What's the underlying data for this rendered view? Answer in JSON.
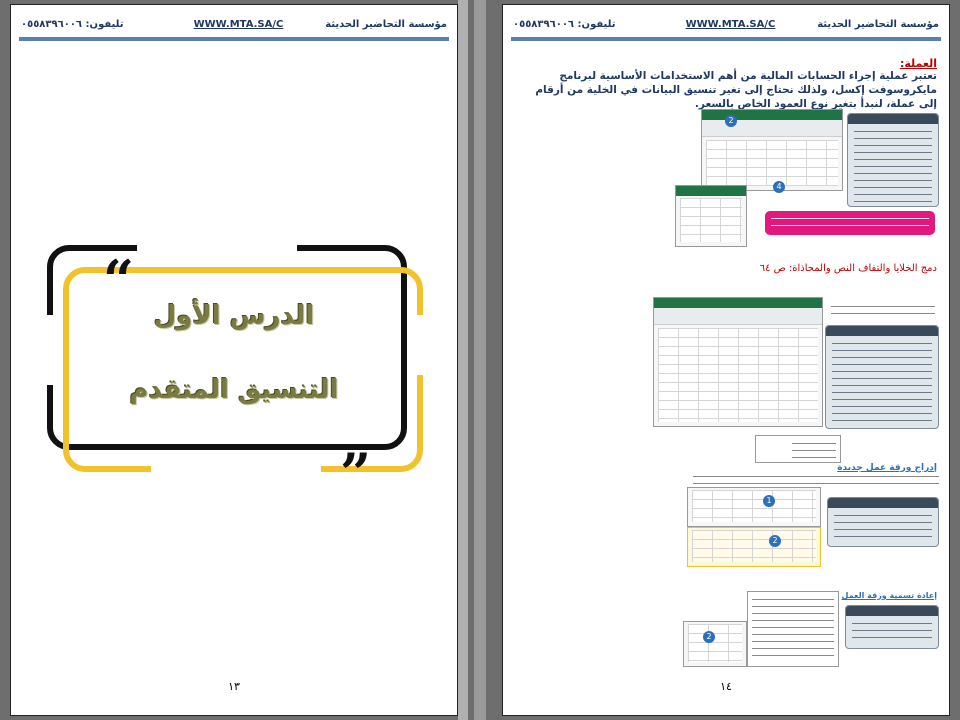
{
  "header": {
    "org": "مؤسسة التحاضير الحديثة",
    "website": "WWW.MTA.SA/C",
    "phone": "تليفون: ٠٥٥٨٣٩٦٠٠٦"
  },
  "left_page": {
    "quote_open": "“",
    "quote_close": "„",
    "lesson": "الدرس الأول",
    "lesson_title": "التنسيق المتقدم",
    "page_number": "١٣"
  },
  "right_page": {
    "section_title": "العملة:",
    "paragraph": "تعتبر عملية إجراء الحسابات المالية من أهم الاستخدامات الأساسية لبرنامج مايكروسوفت إكسل، ولذلك نحتاج إلى تغير تنسيق البيانات في الخلية من أرقام إلى عملة، لنبدأ بتغير نوع العمود الخاص بالسعر.",
    "subheading": "دمج الخلايا والتفاف النص والمحاذاة: ص ٦٤",
    "sheet_heading": "إدراج ورقة عمل جديدة",
    "rename_heading": "إعادة تسمية ورقة العمل",
    "page_number": "١٤"
  },
  "colors": {
    "header_text": "#1f3864",
    "rule": "#5b7fb0",
    "red_heading": "#c00000",
    "frame_black": "#111111",
    "frame_yellow": "#f2c22c",
    "pink_note": "#e2187c"
  }
}
